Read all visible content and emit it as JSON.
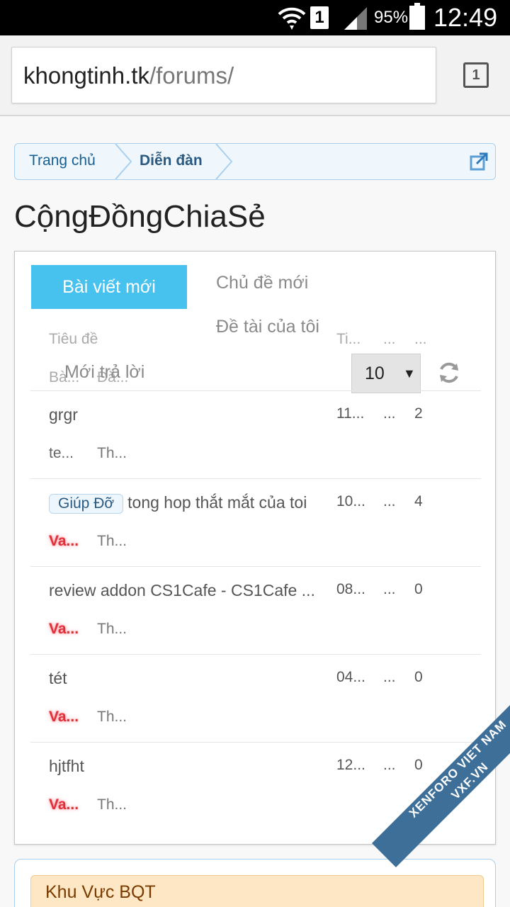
{
  "status_bar": {
    "sim_label": "1",
    "battery": "95%",
    "time": "12:49",
    "icons": [
      "wifi-icon",
      "signal-icon",
      "battery-icon"
    ]
  },
  "browser": {
    "url_host": "khongtinh.tk",
    "url_path": "/forums/",
    "tab_count": "1"
  },
  "breadcrumb": {
    "home": "Trang chủ",
    "current": "Diễn đàn"
  },
  "page_title": "CộngĐồngChiaSẻ",
  "widget": {
    "tabs": [
      "Bài viết mới",
      "Chủ đề mới",
      "Đề tài của tôi",
      "Mới trả lời"
    ],
    "headers": {
      "title": "Tiêu đề",
      "time": "Ti...",
      "dots1": "...",
      "dots2": "...",
      "ba": "Bà...",
      "da": "Đă..."
    },
    "limit_value": "10",
    "rows": [
      {
        "prefix": "",
        "title": "grgr",
        "time": "11...",
        "dots": "...",
        "count": "2",
        "user": "te...",
        "forum": "Th..."
      },
      {
        "prefix": "Giúp Đỡ",
        "title": "tong hop thắt mắt của toi",
        "time": "10...",
        "dots": "...",
        "count": "4",
        "user": "Va...",
        "forum": "Th..."
      },
      {
        "prefix": "",
        "title": "review addon CS1Cafe - CS1Cafe ...",
        "time": "08...",
        "dots": "...",
        "count": "0",
        "user": "Va...",
        "forum": "Th..."
      },
      {
        "prefix": "",
        "title": "tét",
        "time": "04...",
        "dots": "...",
        "count": "0",
        "user": "Va...",
        "forum": "Th..."
      },
      {
        "prefix": "",
        "title": "hjtfht",
        "time": "12...",
        "dots": "...",
        "count": "0",
        "user": "Va...",
        "forum": "Th..."
      }
    ]
  },
  "category": {
    "title": "Khu Vực BQT"
  },
  "watermark": {
    "line1": "XENFORO VIET NAM",
    "line2": "VXF.VN"
  }
}
